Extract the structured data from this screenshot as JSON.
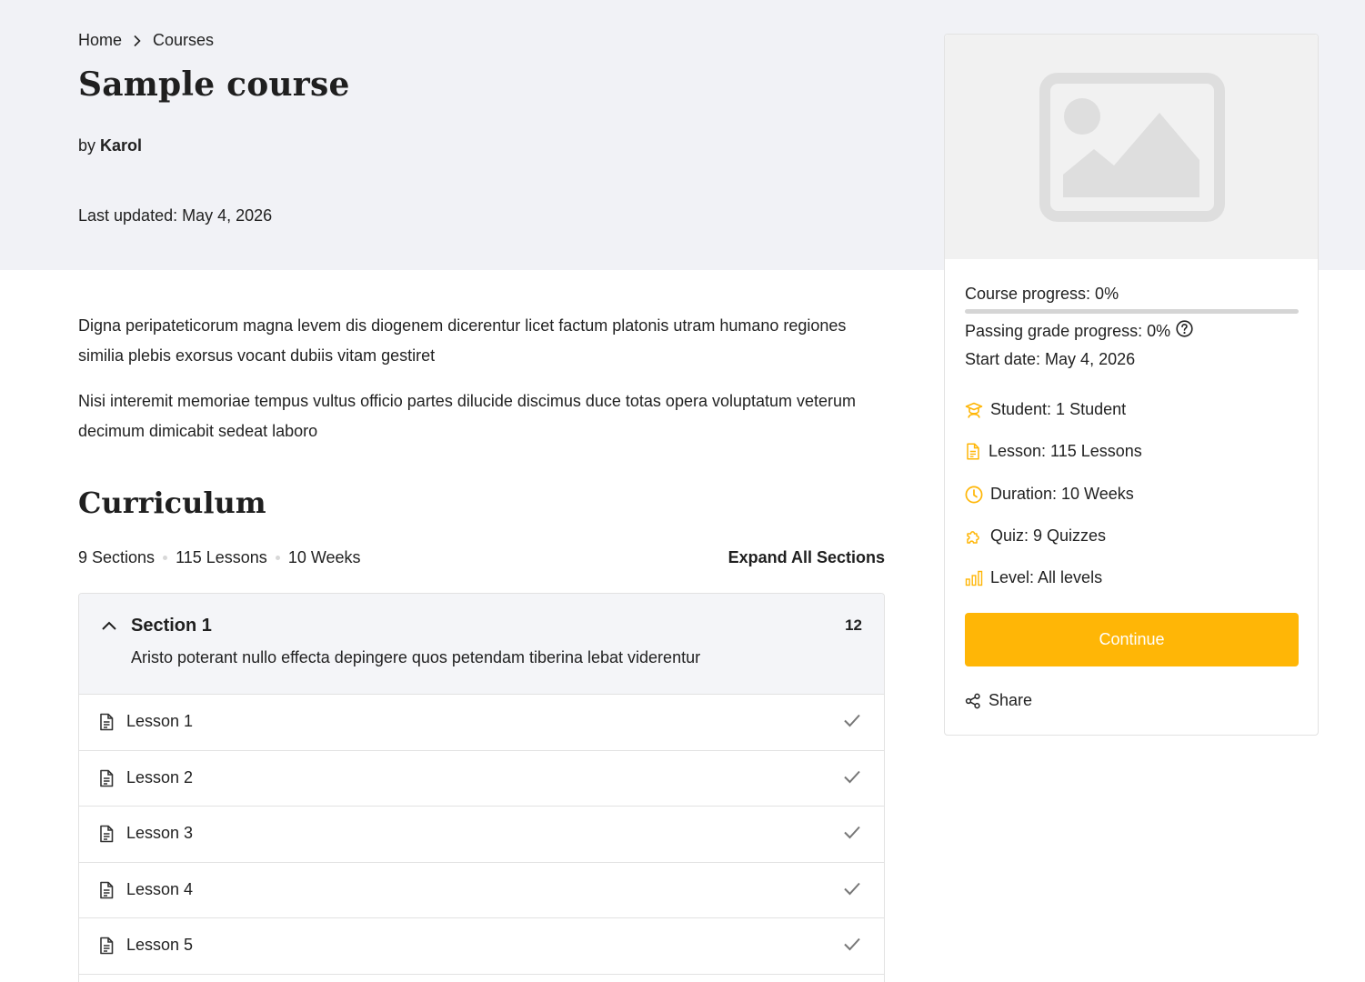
{
  "breadcrumb": {
    "home": "Home",
    "courses": "Courses"
  },
  "course": {
    "title": "Sample course",
    "by_prefix": "by",
    "author": "Karol",
    "last_updated": "Last updated: May 4, 2026",
    "description_1": "Digna peripateticorum magna levem dis diogenem dicerentur licet factum platonis utram humano regiones similia plebis exorsus vocant dubiis vitam gestiret",
    "description_2": "Nisi interemit memoriae tempus vultus officio partes dilucide discimus duce totas opera voluptatum veterum decimum dimicabit sedeat laboro"
  },
  "curriculum": {
    "title": "Curriculum",
    "sections_count": "9 Sections",
    "lessons_count": "115 Lessons",
    "duration": "10 Weeks",
    "expand_label": "Expand All Sections",
    "section": {
      "title": "Section 1",
      "count": "12",
      "description": "Aristo poterant nullo effecta depingere quos petendam tiberina lebat viderentur",
      "lessons": [
        "Lesson 1",
        "Lesson 2",
        "Lesson 3",
        "Lesson 4",
        "Lesson 5"
      ]
    }
  },
  "sidebar": {
    "course_progress": "Course progress: 0%",
    "course_progress_value": 0,
    "passing_grade": "Passing grade progress: 0%",
    "start_date": "Start date: May 4, 2026",
    "meta": {
      "student": "Student: 1 Student",
      "lesson": "Lesson: 115 Lessons",
      "duration": "Duration: 10 Weeks",
      "quiz": "Quiz: 9 Quizzes",
      "level": "Level: All levels"
    },
    "continue_label": "Continue",
    "share_label": "Share"
  },
  "colors": {
    "accent": "#ffb606",
    "hero_bg": "#f1f2f6",
    "section_bg": "#f4f5f8"
  }
}
